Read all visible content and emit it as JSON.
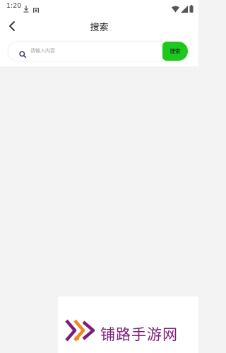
{
  "status_bar": {
    "time": "1:20",
    "icons": [
      "download-icon",
      "square-icon",
      "wifi-icon",
      "signal-icon",
      "battery-icon"
    ]
  },
  "header": {
    "back_icon": "chevron-left-icon",
    "title": "搜索"
  },
  "search": {
    "icon": "search-icon",
    "placeholder": "请输入内容",
    "value": "",
    "button_label": "搜索"
  },
  "watermark": {
    "text": "铺路手游网"
  },
  "colors": {
    "accent": "#1ec81e",
    "page_bg": "#f3f3f3",
    "watermark_purple": "#7b1f78",
    "watermark_orange": "#f08a1c"
  }
}
